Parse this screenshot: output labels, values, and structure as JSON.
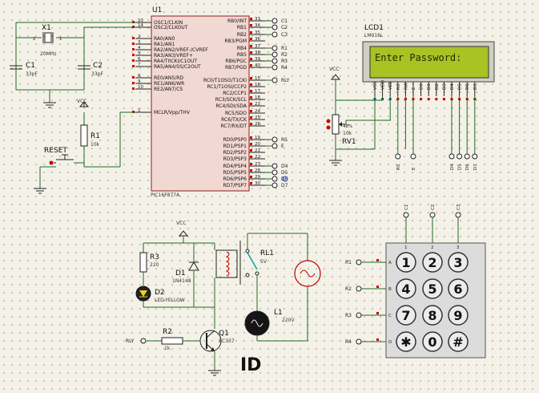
{
  "mcu": {
    "ref": "U1",
    "part": "PIC16F877A",
    "left_pins": [
      {
        "no": "13",
        "name": "OSC1/CLKIN"
      },
      {
        "no": "14",
        "name": "OSC2/CLKOUT"
      },
      {
        "no": "2",
        "name": "RA0/AN0"
      },
      {
        "no": "3",
        "name": "RA1/AN1"
      },
      {
        "no": "4",
        "name": "RA2/AN2/VREF-/CVREF"
      },
      {
        "no": "5",
        "name": "RA3/AN3/VREF+"
      },
      {
        "no": "6",
        "name": "RA4/T0CKI/C1OUT"
      },
      {
        "no": "7",
        "name": "RA5/AN4/SS/C2OUT"
      },
      {
        "no": "8",
        "name": "RE0/AN5/RD"
      },
      {
        "no": "9",
        "name": "RE1/AN6/WR"
      },
      {
        "no": "10",
        "name": "RE2/AN7/CS"
      },
      {
        "no": "1",
        "name": "MCLR/Vpp/THV"
      }
    ],
    "right_pins": [
      {
        "no": "33",
        "name": "RB0/INT",
        "net": "C1"
      },
      {
        "no": "34",
        "name": "RB1",
        "net": "C2"
      },
      {
        "no": "35",
        "name": "RB2",
        "net": "C3"
      },
      {
        "no": "36",
        "name": "RB3/PGM",
        "net": ""
      },
      {
        "no": "37",
        "name": "RB4",
        "net": "R1"
      },
      {
        "no": "38",
        "name": "RB5",
        "net": "R2"
      },
      {
        "no": "39",
        "name": "RB6/PGC",
        "net": "R3"
      },
      {
        "no": "40",
        "name": "RB7/PGD",
        "net": "R4"
      },
      {
        "no": "15",
        "name": "RC0/T1OSO/T1CKI",
        "net": "RLY"
      },
      {
        "no": "16",
        "name": "RC1/T1OSI/CCP2",
        "net": ""
      },
      {
        "no": "17",
        "name": "RC2/CCP1",
        "net": ""
      },
      {
        "no": "18",
        "name": "RC3/SCK/SCL",
        "net": ""
      },
      {
        "no": "23",
        "name": "RC4/SDI/SDA",
        "net": ""
      },
      {
        "no": "24",
        "name": "RC5/SDO",
        "net": ""
      },
      {
        "no": "25",
        "name": "RC6/TX/CK",
        "net": ""
      },
      {
        "no": "26",
        "name": "RC7/RX/DT",
        "net": ""
      },
      {
        "no": "19",
        "name": "RD0/PSP0",
        "net": "RS"
      },
      {
        "no": "20",
        "name": "RD1/PSP1",
        "net": "E"
      },
      {
        "no": "21",
        "name": "RD2/PSP2",
        "net": ""
      },
      {
        "no": "22",
        "name": "RD3/PSP3",
        "net": ""
      },
      {
        "no": "27",
        "name": "RD4/PSP4",
        "net": "D4"
      },
      {
        "no": "28",
        "name": "RD5/PSP5",
        "net": "D5"
      },
      {
        "no": "29",
        "name": "RD6/PSP6",
        "net": "D6"
      },
      {
        "no": "30",
        "name": "RD7/PSP7",
        "net": "D7"
      }
    ]
  },
  "crystal": {
    "ref": "X1",
    "value": "20MHz",
    "pin1": "1",
    "pin2": "2"
  },
  "c1": {
    "ref": "C1",
    "value": "33pF"
  },
  "c2": {
    "ref": "C2",
    "value": "33pF"
  },
  "r1": {
    "ref": "R1",
    "value": "10k"
  },
  "reset": {
    "label": "RESET"
  },
  "vcc": "VCC",
  "lcd": {
    "ref": "LCD1",
    "part": "LM016L",
    "text": "Enter Password:",
    "pins": [
      "VSS",
      "VDD",
      "VEE",
      "RS",
      "RW",
      "E",
      "D0",
      "D1",
      "D2",
      "D3",
      "D4",
      "D5",
      "D6",
      "D7"
    ],
    "nets": [
      "RS",
      "E",
      "D4",
      "D5",
      "D6",
      "D7"
    ]
  },
  "rv1": {
    "ref": "RV1",
    "value": "10k",
    "pct": "48%"
  },
  "relay_circuit": {
    "r3": {
      "ref": "R3",
      "value": "220"
    },
    "d2": {
      "ref": "D2",
      "value": "LED-YELLOW"
    },
    "d1": {
      "ref": "D1",
      "value": "1N4148"
    },
    "rl1": {
      "ref": "RL1",
      "value": "5V"
    },
    "l1": {
      "ref": "L1",
      "value": "220V"
    },
    "r2": {
      "ref": "R2",
      "value": "1k"
    },
    "q1": {
      "ref": "Q1",
      "value": "BC337"
    },
    "rly_net": "RLY"
  },
  "keypad": {
    "cols": [
      "C1",
      "C2",
      "C3"
    ],
    "rows": [
      "R1",
      "R2",
      "R3",
      "R4"
    ],
    "row_letters": [
      "A",
      "B",
      "C",
      "D"
    ],
    "col_numbers": [
      "1",
      "2",
      "3"
    ],
    "keys": [
      "1",
      "2",
      "3",
      "4",
      "5",
      "6",
      "7",
      "8",
      "9",
      "✱",
      "0",
      "#"
    ]
  },
  "colors": {
    "wire": "#1f6b1f",
    "lcd_bg": "#a9c224",
    "pin_red": "#c00000",
    "pin_blue": "#2040c0",
    "chip": "#f2d8d2"
  }
}
